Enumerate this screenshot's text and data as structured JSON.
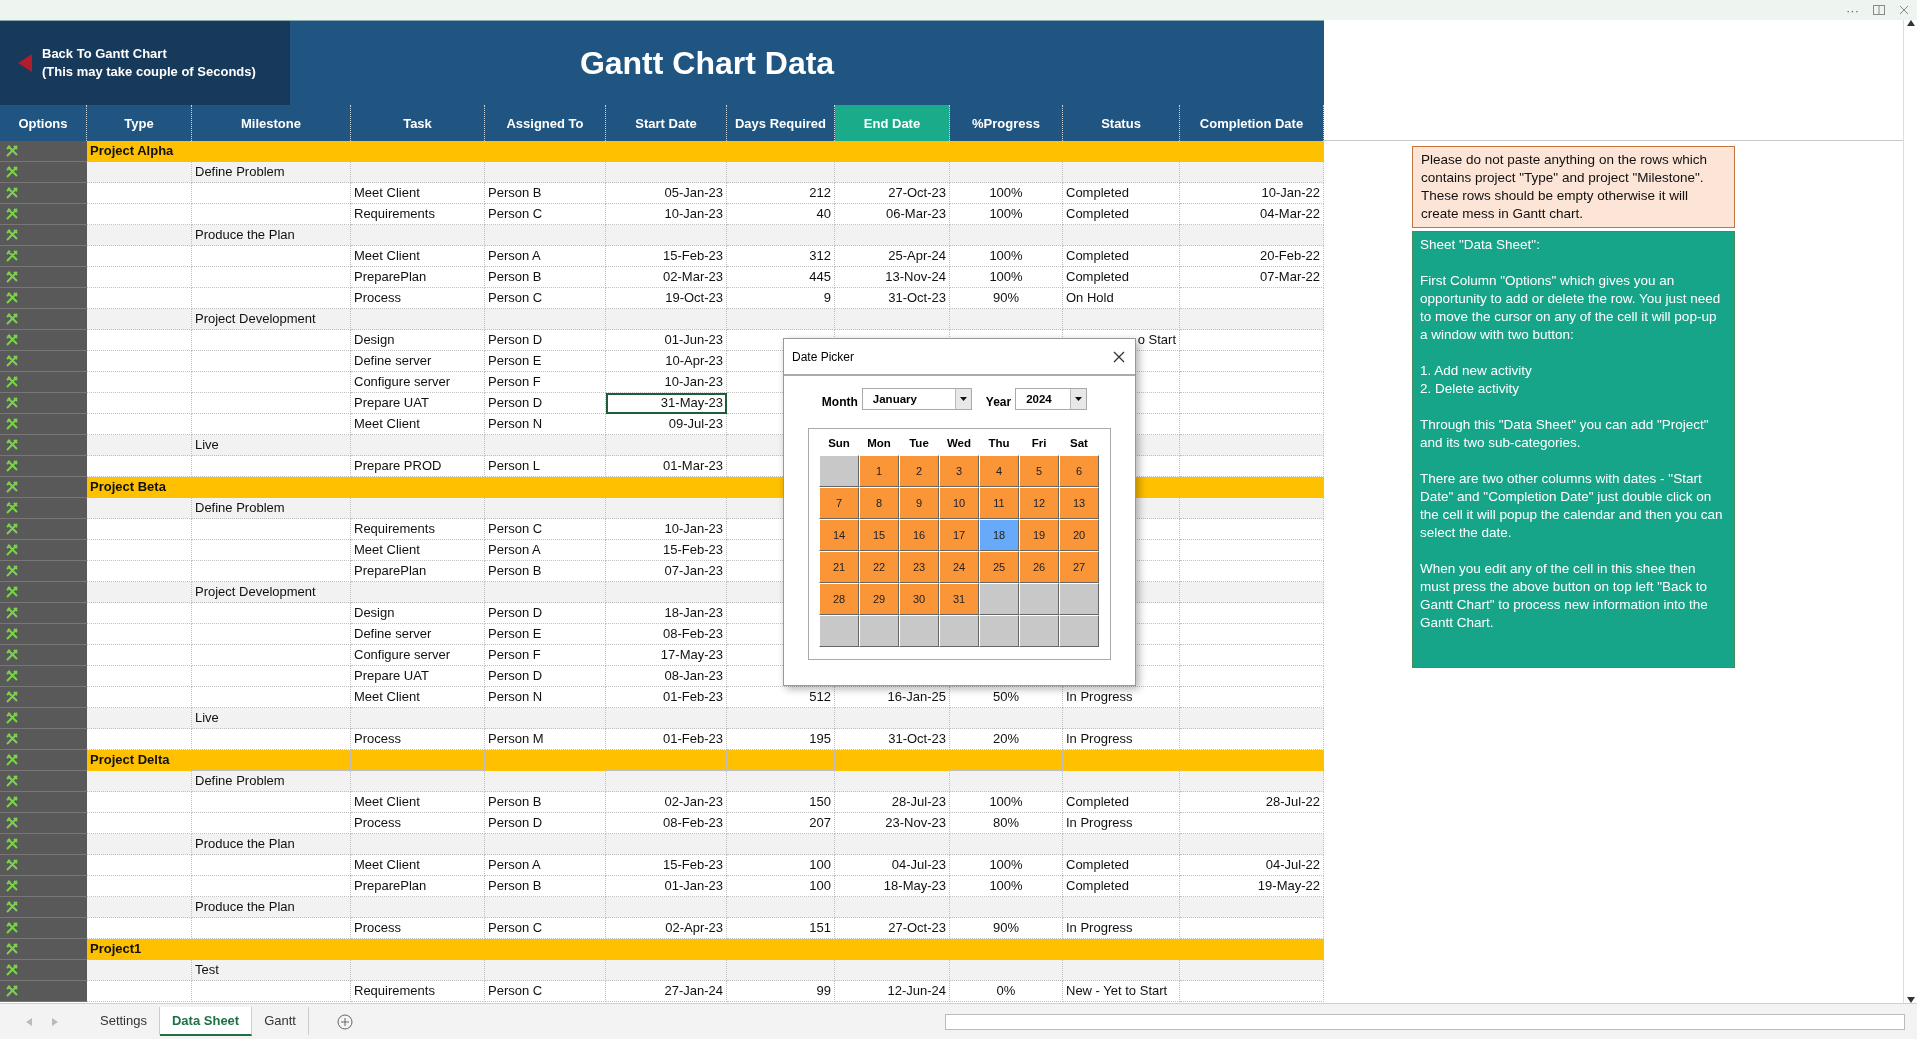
{
  "top_bar": {
    "more": "···"
  },
  "banner": {
    "back_button": [
      "Back To Gantt Chart",
      "(This may take couple of Seconds)"
    ],
    "title": "Gantt Chart Data"
  },
  "columns": [
    {
      "label": "Options",
      "selected": false
    },
    {
      "label": "Type",
      "selected": false
    },
    {
      "label": "Milestone",
      "selected": false
    },
    {
      "label": "Task",
      "selected": false
    },
    {
      "label": "Assigned To",
      "selected": false
    },
    {
      "label": "Start Date",
      "selected": false
    },
    {
      "label": "Days Required",
      "selected": false
    },
    {
      "label": "End Date",
      "selected": true
    },
    {
      "label": "%Progress",
      "selected": false
    },
    {
      "label": "Status",
      "selected": false
    },
    {
      "label": "Completion Date",
      "selected": false
    }
  ],
  "rows": [
    {
      "kind": "project",
      "type": "Project Alpha",
      "selected": false
    },
    {
      "kind": "milestone",
      "milestone": "Define Problem",
      "selected": false
    },
    {
      "kind": "task",
      "task": "Meet Client",
      "assigned": "Person B",
      "start": "05-Jan-23",
      "days": "212",
      "end": "27-Oct-23",
      "progress": "100%",
      "status": "Completed",
      "completion": "10-Jan-22",
      "selected": false
    },
    {
      "kind": "task",
      "task": "Requirements",
      "assigned": "Person C",
      "start": "10-Jan-23",
      "days": "40",
      "end": "06-Mar-23",
      "progress": "100%",
      "status": "Completed",
      "completion": "04-Mar-22",
      "selected": false
    },
    {
      "kind": "milestone",
      "milestone": "Produce the Plan",
      "selected": false
    },
    {
      "kind": "task",
      "task": "Meet Client",
      "assigned": "Person A",
      "start": "15-Feb-23",
      "days": "312",
      "end": "25-Apr-24",
      "progress": "100%",
      "status": "Completed",
      "completion": "20-Feb-22",
      "selected": false
    },
    {
      "kind": "task",
      "task": "PreparePlan",
      "assigned": "Person B",
      "start": "02-Mar-23",
      "days": "445",
      "end": "13-Nov-24",
      "progress": "100%",
      "status": "Completed",
      "completion": "07-Mar-22",
      "selected": false
    },
    {
      "kind": "task",
      "task": "Process",
      "assigned": "Person C",
      "start": "19-Oct-23",
      "days": "9",
      "end": "31-Oct-23",
      "progress": "90%",
      "status": "On Hold",
      "selected": false
    },
    {
      "kind": "milestone",
      "milestone": "Project Development",
      "selected": false
    },
    {
      "kind": "task",
      "task": "Design",
      "assigned": "Person D",
      "start": "01-Jun-23",
      "status": "o Start",
      "status_clipped": true,
      "selected": false
    },
    {
      "kind": "task",
      "task": "Define server",
      "assigned": "Person E",
      "start": "10-Apr-23",
      "selected": false
    },
    {
      "kind": "task",
      "task": "Configure server",
      "assigned": "Person F",
      "start": "10-Jan-23",
      "selected": false
    },
    {
      "kind": "task",
      "task": "Prepare UAT",
      "assigned": "Person D",
      "start": "31-May-23",
      "selected": true
    },
    {
      "kind": "task",
      "task": "Meet Client",
      "assigned": "Person N",
      "start": "09-Jul-23",
      "selected": false
    },
    {
      "kind": "milestone",
      "milestone": "Live",
      "selected": false
    },
    {
      "kind": "task",
      "task": "Prepare PROD",
      "assigned": "Person L",
      "start": "01-Mar-23",
      "selected": false
    },
    {
      "kind": "project",
      "type": "Project Beta",
      "selected": false
    },
    {
      "kind": "milestone",
      "milestone": "Define Problem",
      "selected": false
    },
    {
      "kind": "task",
      "task": "Requirements",
      "assigned": "Person C",
      "start": "10-Jan-23",
      "selected": false
    },
    {
      "kind": "task",
      "task": "Meet Client",
      "assigned": "Person A",
      "start": "15-Feb-23",
      "selected": false
    },
    {
      "kind": "task",
      "task": "PreparePlan",
      "assigned": "Person B",
      "start": "07-Jan-23",
      "selected": false
    },
    {
      "kind": "milestone",
      "milestone": "Project Development",
      "selected": false
    },
    {
      "kind": "task",
      "task": "Design",
      "assigned": "Person D",
      "start": "18-Jan-23",
      "selected": false
    },
    {
      "kind": "task",
      "task": "Define server",
      "assigned": "Person E",
      "start": "08-Feb-23",
      "selected": false
    },
    {
      "kind": "task",
      "task": "Configure server",
      "assigned": "Person F",
      "start": "17-May-23",
      "selected": false
    },
    {
      "kind": "task",
      "task": "Prepare UAT",
      "assigned": "Person D",
      "start": "08-Jan-23",
      "selected": false
    },
    {
      "kind": "task",
      "task": "Meet Client",
      "assigned": "Person N",
      "start": "01-Feb-23",
      "days": "512",
      "end": "16-Jan-25",
      "progress": "50%",
      "status": "In Progress",
      "selected": false
    },
    {
      "kind": "milestone",
      "milestone": "Live",
      "selected": false
    },
    {
      "kind": "task",
      "task": "Process",
      "assigned": "Person M",
      "start": "01-Feb-23",
      "days": "195",
      "end": "31-Oct-23",
      "progress": "20%",
      "status": "In Progress",
      "selected": false
    },
    {
      "kind": "project",
      "type": "Project Delta",
      "selected": false
    },
    {
      "kind": "milestone",
      "milestone": "Define Problem",
      "selected": false
    },
    {
      "kind": "task",
      "task": "Meet Client",
      "assigned": "Person B",
      "start": "02-Jan-23",
      "days": "150",
      "end": "28-Jul-23",
      "progress": "100%",
      "status": "Completed",
      "completion": "28-Jul-22",
      "selected": false
    },
    {
      "kind": "task",
      "task": "Process",
      "assigned": "Person D",
      "start": "08-Feb-23",
      "days": "207",
      "end": "23-Nov-23",
      "progress": "80%",
      "status": "In Progress",
      "selected": false
    },
    {
      "kind": "milestone",
      "milestone": "Produce the Plan",
      "selected": false
    },
    {
      "kind": "task",
      "task": "Meet Client",
      "assigned": "Person A",
      "start": "15-Feb-23",
      "days": "100",
      "end": "04-Jul-23",
      "progress": "100%",
      "status": "Completed",
      "completion": "04-Jul-22",
      "selected": false
    },
    {
      "kind": "task",
      "task": "PreparePlan",
      "assigned": "Person B",
      "start": "01-Jan-23",
      "days": "100",
      "end": "18-May-23",
      "progress": "100%",
      "status": "Completed",
      "completion": "19-May-22",
      "selected": false
    },
    {
      "kind": "milestone",
      "milestone": "Produce the Plan",
      "selected": false
    },
    {
      "kind": "task",
      "task": "Process",
      "assigned": "Person C",
      "start": "02-Apr-23",
      "days": "151",
      "end": "27-Oct-23",
      "progress": "90%",
      "status": "In Progress",
      "selected": false
    },
    {
      "kind": "project",
      "type": "Project1",
      "selected": false
    },
    {
      "kind": "milestone",
      "milestone": "Test",
      "selected": false
    },
    {
      "kind": "task",
      "task": "Requirements",
      "assigned": "Person C",
      "start": "27-Jan-24",
      "days": "99",
      "end": "12-Jun-24",
      "progress": "0%",
      "status": "New - Yet to Start",
      "selected": false
    }
  ],
  "notes": {
    "warning": "Please do not paste anything on the rows which contains project \"Type\" and project \"Milestone\". These rows should be empty otherwise it will create mess in Gantt chart.",
    "info": [
      "Sheet \"Data Sheet\":",
      "First Column \"Options\" which gives you an opportunity to add or delete the row. You just need to move the cursor on any of the cell it will pop-up a window with two button:",
      "1. Add new activity\n2. Delete activity",
      "Through this \"Data Sheet\" you can add \"Project\" and its two sub-categories.",
      "There are two other columns with dates - \"Start Date\" and \"Completion Date\" just double click on the cell it will popup the calendar and then you can select the date.",
      "When you edit any of the cell in this shee then must press the above button on  top  left \"Back to Gantt Chart\" to process new information into the Gantt Chart."
    ]
  },
  "date_picker": {
    "title": "Date Picker",
    "month_label": "Month",
    "month": "January",
    "year_label": "Year",
    "year": "2024",
    "weekdays": [
      "Sun",
      "Mon",
      "Tue",
      "Wed",
      "Thu",
      "Fri",
      "Sat"
    ],
    "days": [
      {
        "kind": "blank"
      },
      {
        "kind": "day",
        "label": "1",
        "selected": false
      },
      {
        "kind": "day",
        "label": "2",
        "selected": false
      },
      {
        "kind": "day",
        "label": "3",
        "selected": false
      },
      {
        "kind": "day",
        "label": "4",
        "selected": false
      },
      {
        "kind": "day",
        "label": "5",
        "selected": false
      },
      {
        "kind": "day",
        "label": "6",
        "selected": false
      },
      {
        "kind": "day",
        "label": "7",
        "selected": false
      },
      {
        "kind": "day",
        "label": "8",
        "selected": false
      },
      {
        "kind": "day",
        "label": "9",
        "selected": false
      },
      {
        "kind": "day",
        "label": "10",
        "selected": false
      },
      {
        "kind": "day",
        "label": "11",
        "selected": false
      },
      {
        "kind": "day",
        "label": "12",
        "selected": false
      },
      {
        "kind": "day",
        "label": "13",
        "selected": false
      },
      {
        "kind": "day",
        "label": "14",
        "selected": false
      },
      {
        "kind": "day",
        "label": "15",
        "selected": false
      },
      {
        "kind": "day",
        "label": "16",
        "selected": false
      },
      {
        "kind": "day",
        "label": "17",
        "selected": false
      },
      {
        "kind": "day",
        "label": "18",
        "selected": true
      },
      {
        "kind": "day",
        "label": "19",
        "selected": false
      },
      {
        "kind": "day",
        "label": "20",
        "selected": false
      },
      {
        "kind": "day",
        "label": "21",
        "selected": false
      },
      {
        "kind": "day",
        "label": "22",
        "selected": false
      },
      {
        "kind": "day",
        "label": "23",
        "selected": false
      },
      {
        "kind": "day",
        "label": "24",
        "selected": false
      },
      {
        "kind": "day",
        "label": "25",
        "selected": false
      },
      {
        "kind": "day",
        "label": "26",
        "selected": false
      },
      {
        "kind": "day",
        "label": "27",
        "selected": false
      },
      {
        "kind": "day",
        "label": "28",
        "selected": false
      },
      {
        "kind": "day",
        "label": "29",
        "selected": false
      },
      {
        "kind": "day",
        "label": "30",
        "selected": false
      },
      {
        "kind": "day",
        "label": "31",
        "selected": false
      },
      {
        "kind": "blank"
      },
      {
        "kind": "blank"
      },
      {
        "kind": "blank"
      },
      {
        "kind": "blank"
      },
      {
        "kind": "blank"
      },
      {
        "kind": "blank"
      },
      {
        "kind": "blank"
      },
      {
        "kind": "blank"
      },
      {
        "kind": "blank"
      },
      {
        "kind": "blank"
      }
    ]
  },
  "sheet_tabs": [
    {
      "label": "Settings",
      "selected": false
    },
    {
      "label": "Data Sheet",
      "selected": true
    },
    {
      "label": "Gantt",
      "selected": false
    }
  ]
}
